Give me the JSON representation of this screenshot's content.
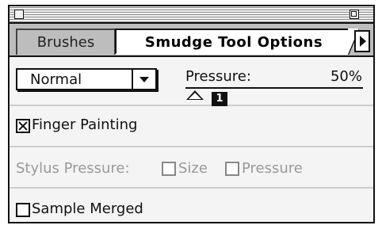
{
  "tabs": [
    {
      "label": "Brushes",
      "active": false
    },
    {
      "label": "Smudge Tool Options",
      "active": true
    }
  ],
  "mode": {
    "selected": "Normal"
  },
  "pressure": {
    "label": "Pressure:",
    "value_text": "50%",
    "value": 50,
    "badge": "1"
  },
  "finger_painting": {
    "label": "Finger Painting",
    "checked": true
  },
  "stylus": {
    "label": "Stylus Pressure:",
    "size_label": "Size",
    "size_checked": false,
    "pressure_label": "Pressure",
    "pressure_checked": false,
    "enabled": false
  },
  "sample_merged": {
    "label": "Sample Merged",
    "checked": false
  },
  "colors": {
    "tab_bar": "#bdbdbd",
    "panel": "#f4f4f4",
    "disabled_text": "#9a9a9a"
  }
}
